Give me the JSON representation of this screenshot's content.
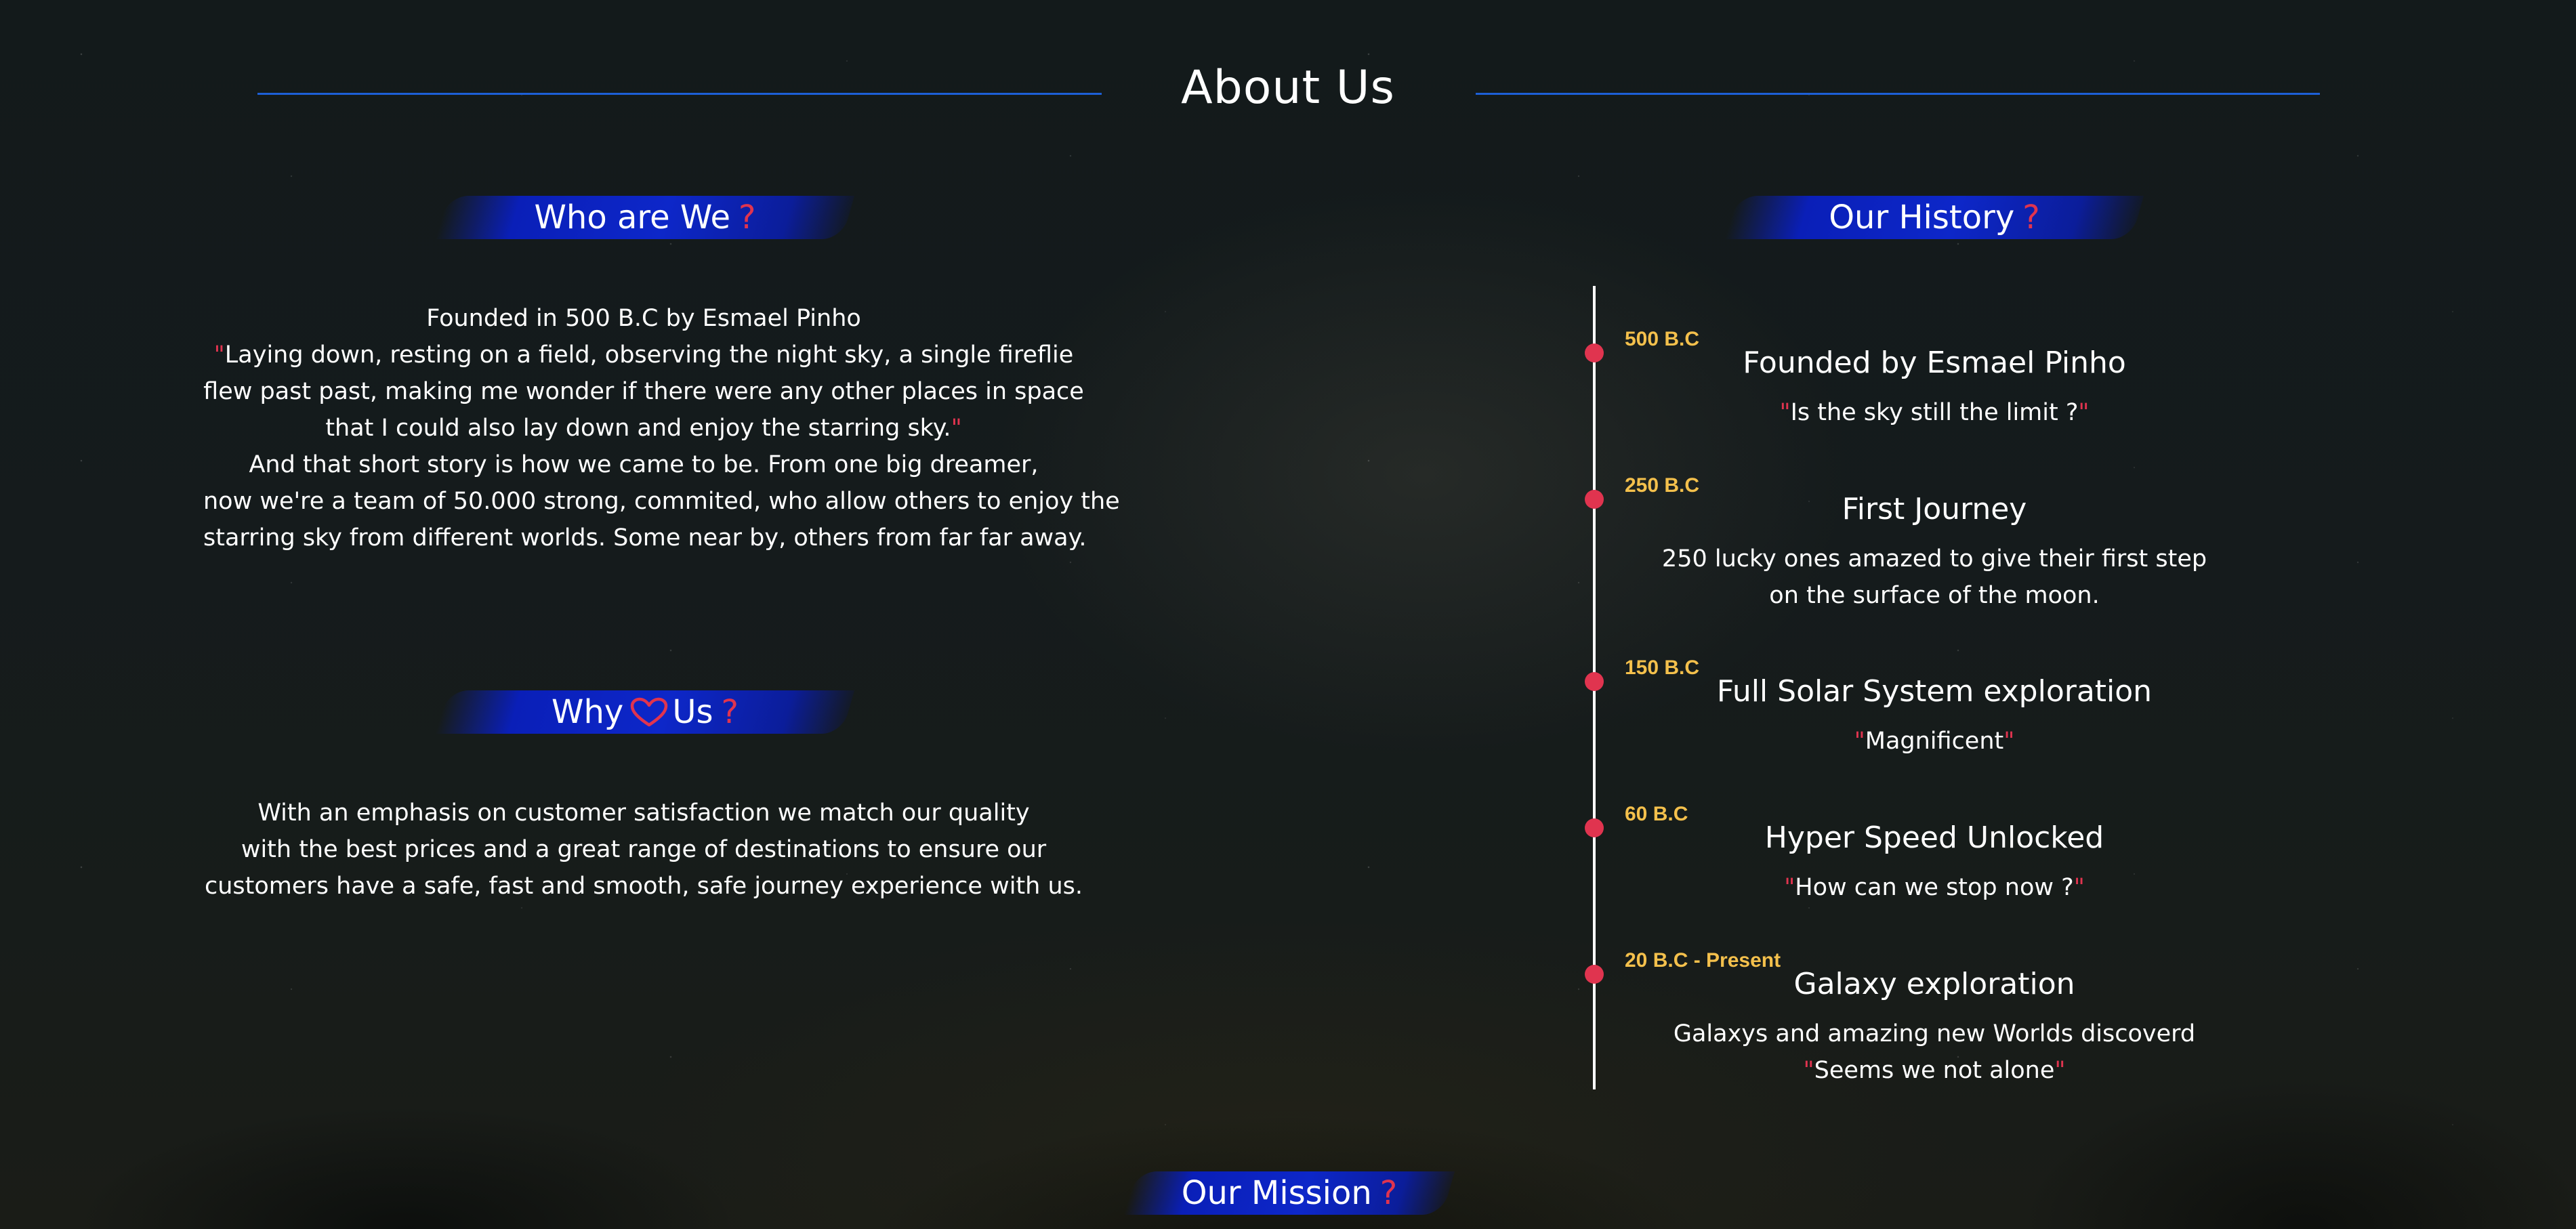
{
  "header": {
    "title": "About Us"
  },
  "who": {
    "heading": "Who are We",
    "q": "?",
    "lines": [
      {
        "text": "Founded in 500 B.C by Esmael Pinho"
      },
      {
        "open": "\"",
        "text": "Laying down, resting on a field, observing the night sky, a single fireflie"
      },
      {
        "text": "flew past past, making me wonder if there were any other places in space"
      },
      {
        "text": "that I could also lay down and enjoy the starring sky.",
        "close": "\""
      },
      {
        "text": "And that short story is how we came to be. From one big dreamer,"
      },
      {
        "text": "now we're a team of 50.000 strong, commited, who allow others to enjoy the"
      },
      {
        "text": "starring sky from different worlds. Some near by, others from far far away."
      }
    ]
  },
  "why": {
    "heading_before": "Why",
    "heading_after": "Us",
    "q": "?",
    "heart_icon": "heart-outline-icon",
    "lines": [
      "With an emphasis on customer satisfaction we match our quality",
      "with the best prices and a great range of destinations to ensure our",
      "customers have a safe, fast and smooth, safe journey experience with us."
    ]
  },
  "history": {
    "heading": "Our History",
    "q": "?",
    "events": [
      {
        "date": "500 B.C",
        "title": "Founded by Esmael Pinho",
        "quote": "Is the sky still the limit ?"
      },
      {
        "date": "250 B.C",
        "title": "First Journey",
        "desc_lines": [
          "250 lucky ones amazed to give their first step",
          "on the surface of the moon."
        ]
      },
      {
        "date": "150 B.C",
        "title": "Full Solar System exploration",
        "quote": "Magnificent"
      },
      {
        "date": "60 B.C",
        "title": "Hyper Speed Unlocked",
        "quote": "How can we stop now ?"
      },
      {
        "date": "20 B.C - Present",
        "title": "Galaxy exploration",
        "desc_lines": [
          "Galaxys and amazing new Worlds discoverd"
        ],
        "quote": "Seems we not alone"
      }
    ]
  },
  "mission": {
    "heading": "Our Mission",
    "q": "?"
  },
  "colors": {
    "accent_red": "#e0344f",
    "date_gold": "#f4c04c",
    "pill_blue": "#0d27c9",
    "line_blue": "#1d5fd6"
  },
  "quote_mark": "\""
}
